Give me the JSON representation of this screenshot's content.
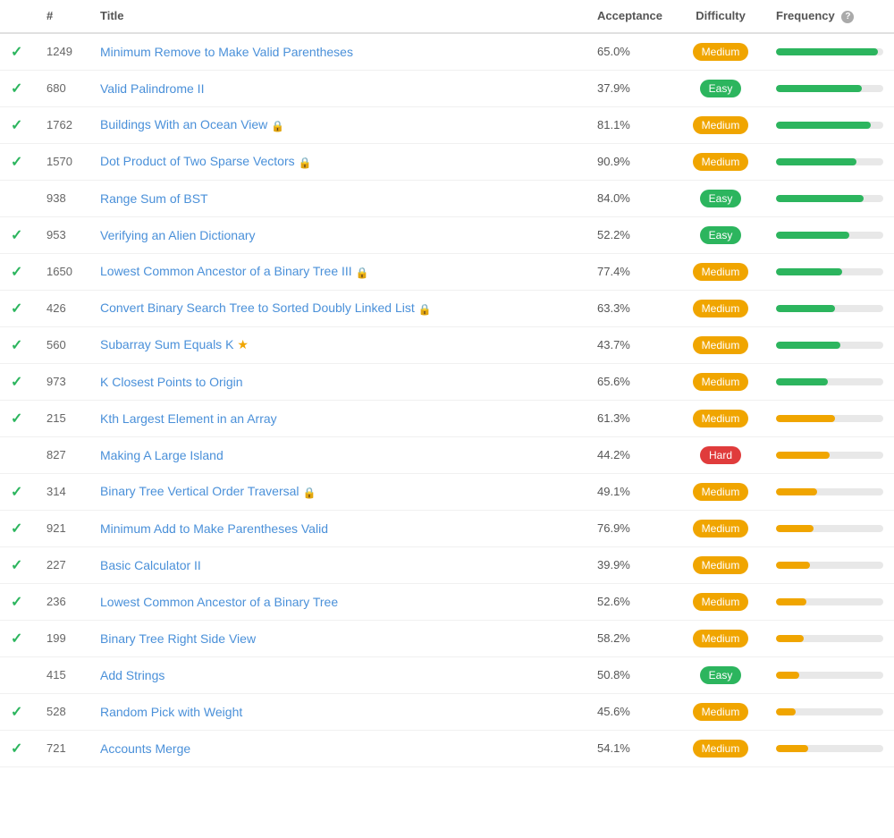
{
  "header": {
    "cols": [
      "#",
      "Title",
      "Acceptance",
      "Difficulty",
      "Frequency"
    ]
  },
  "rows": [
    {
      "checked": true,
      "num": "1249",
      "title": "Minimum Remove to Make Valid Parentheses",
      "lock": false,
      "star": false,
      "acceptance": "65.0%",
      "difficulty": "Medium",
      "freq_pct": 95,
      "freq_color": "green"
    },
    {
      "checked": true,
      "num": "680",
      "title": "Valid Palindrome II",
      "lock": false,
      "star": false,
      "acceptance": "37.9%",
      "difficulty": "Easy",
      "freq_pct": 80,
      "freq_color": "green"
    },
    {
      "checked": true,
      "num": "1762",
      "title": "Buildings With an Ocean View",
      "lock": true,
      "star": false,
      "acceptance": "81.1%",
      "difficulty": "Medium",
      "freq_pct": 88,
      "freq_color": "green"
    },
    {
      "checked": true,
      "num": "1570",
      "title": "Dot Product of Two Sparse Vectors",
      "lock": true,
      "star": false,
      "acceptance": "90.9%",
      "difficulty": "Medium",
      "freq_pct": 75,
      "freq_color": "green"
    },
    {
      "checked": false,
      "num": "938",
      "title": "Range Sum of BST",
      "lock": false,
      "star": false,
      "acceptance": "84.0%",
      "difficulty": "Easy",
      "freq_pct": 82,
      "freq_color": "green"
    },
    {
      "checked": true,
      "num": "953",
      "title": "Verifying an Alien Dictionary",
      "lock": false,
      "star": false,
      "acceptance": "52.2%",
      "difficulty": "Easy",
      "freq_pct": 68,
      "freq_color": "green"
    },
    {
      "checked": true,
      "num": "1650",
      "title": "Lowest Common Ancestor of a Binary Tree III",
      "lock": true,
      "star": false,
      "acceptance": "77.4%",
      "difficulty": "Medium",
      "freq_pct": 62,
      "freq_color": "green"
    },
    {
      "checked": true,
      "num": "426",
      "title": "Convert Binary Search Tree to Sorted Doubly Linked List",
      "lock": true,
      "star": false,
      "acceptance": "63.3%",
      "difficulty": "Medium",
      "freq_pct": 55,
      "freq_color": "green"
    },
    {
      "checked": true,
      "num": "560",
      "title": "Subarray Sum Equals K",
      "lock": false,
      "star": true,
      "acceptance": "43.7%",
      "difficulty": "Medium",
      "freq_pct": 60,
      "freq_color": "green"
    },
    {
      "checked": true,
      "num": "973",
      "title": "K Closest Points to Origin",
      "lock": false,
      "star": false,
      "acceptance": "65.6%",
      "difficulty": "Medium",
      "freq_pct": 48,
      "freq_color": "green"
    },
    {
      "checked": true,
      "num": "215",
      "title": "Kth Largest Element in an Array",
      "lock": false,
      "star": false,
      "acceptance": "61.3%",
      "difficulty": "Medium",
      "freq_pct": 55,
      "freq_color": "orange"
    },
    {
      "checked": false,
      "num": "827",
      "title": "Making A Large Island",
      "lock": false,
      "star": false,
      "acceptance": "44.2%",
      "difficulty": "Hard",
      "freq_pct": 50,
      "freq_color": "orange"
    },
    {
      "checked": true,
      "num": "314",
      "title": "Binary Tree Vertical Order Traversal",
      "lock": true,
      "star": false,
      "acceptance": "49.1%",
      "difficulty": "Medium",
      "freq_pct": 38,
      "freq_color": "orange"
    },
    {
      "checked": true,
      "num": "921",
      "title": "Minimum Add to Make Parentheses Valid",
      "lock": false,
      "star": false,
      "acceptance": "76.9%",
      "difficulty": "Medium",
      "freq_pct": 35,
      "freq_color": "orange"
    },
    {
      "checked": true,
      "num": "227",
      "title": "Basic Calculator II",
      "lock": false,
      "star": false,
      "acceptance": "39.9%",
      "difficulty": "Medium",
      "freq_pct": 32,
      "freq_color": "orange"
    },
    {
      "checked": true,
      "num": "236",
      "title": "Lowest Common Ancestor of a Binary Tree",
      "lock": false,
      "star": false,
      "acceptance": "52.6%",
      "difficulty": "Medium",
      "freq_pct": 28,
      "freq_color": "orange"
    },
    {
      "checked": true,
      "num": "199",
      "title": "Binary Tree Right Side View",
      "lock": false,
      "star": false,
      "acceptance": "58.2%",
      "difficulty": "Medium",
      "freq_pct": 26,
      "freq_color": "orange"
    },
    {
      "checked": false,
      "num": "415",
      "title": "Add Strings",
      "lock": false,
      "star": false,
      "acceptance": "50.8%",
      "difficulty": "Easy",
      "freq_pct": 22,
      "freq_color": "orange"
    },
    {
      "checked": true,
      "num": "528",
      "title": "Random Pick with Weight",
      "lock": false,
      "star": false,
      "acceptance": "45.6%",
      "difficulty": "Medium",
      "freq_pct": 18,
      "freq_color": "orange"
    },
    {
      "checked": true,
      "num": "721",
      "title": "Accounts Merge",
      "lock": false,
      "star": false,
      "acceptance": "54.1%",
      "difficulty": "Medium",
      "freq_pct": 30,
      "freq_color": "orange"
    }
  ],
  "icons": {
    "check": "✓",
    "lock": "🔒",
    "star": "★",
    "help": "?"
  }
}
